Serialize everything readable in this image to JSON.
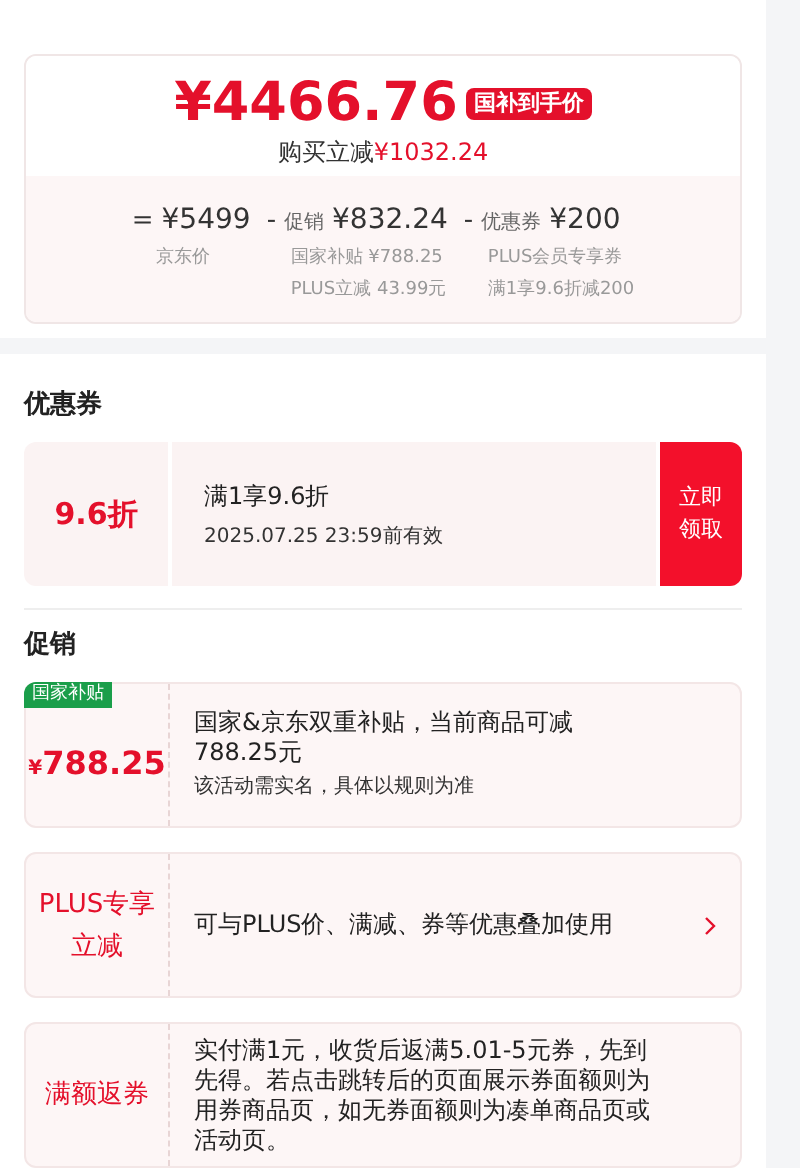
{
  "price_card": {
    "price": "¥4466.76",
    "price_tag": "国补到手价",
    "saving_label": "购买立减",
    "saving_value": "¥1032.24",
    "breakdown": [
      {
        "op": "=",
        "value": "¥5499",
        "notes": [
          "京东价"
        ]
      },
      {
        "op": "-",
        "label": "促销",
        "value": "¥832.24",
        "notes": [
          "国家补贴 ¥788.25",
          "PLUS立减 43.99元"
        ]
      },
      {
        "op": "-",
        "label": "优惠券",
        "value": "¥200",
        "notes": [
          "PLUS会员专享券",
          "满1享9.6折减200"
        ]
      }
    ]
  },
  "coupons": {
    "title": "优惠券",
    "items": [
      {
        "value": "9.6折",
        "title": "满1享9.6折",
        "expiry": "2025.07.25 23:59前有效",
        "action": "立即领取"
      }
    ]
  },
  "promotions": {
    "title": "促销",
    "items": [
      {
        "kind": "amount",
        "badge": "国家补贴",
        "currency": "¥",
        "amount": "788.25",
        "text": "国家&京东双重补贴，当前商品可减788.25元",
        "note": "该活动需实名，具体以规则为准",
        "link": false
      },
      {
        "kind": "label",
        "label": "PLUS专享立减",
        "text": "可与PLUS价、满减、券等优惠叠加使用",
        "link": true
      },
      {
        "kind": "label",
        "label": "满额返券",
        "text": "实付满1元，收货后返满5.01-5元券，先到先得。若点击跳转后的页面展示券面额则为用券商品页，如无券面额则为凑单商品页或活动页。",
        "link": false
      }
    ]
  }
}
